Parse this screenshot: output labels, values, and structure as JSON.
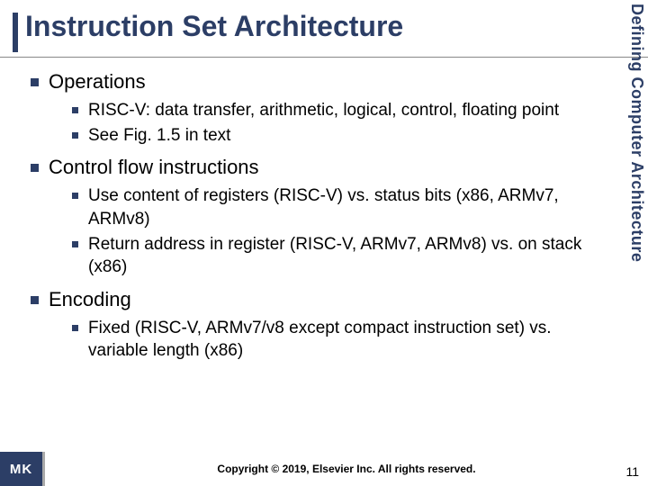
{
  "title": "Instruction Set Architecture",
  "sideLabel": "Defining Computer Architecture",
  "sections": [
    {
      "heading": "Operations",
      "items": [
        "RISC-V:  data transfer, arithmetic, logical, control, floating point",
        "See Fig. 1.5 in text"
      ]
    },
    {
      "heading": "Control flow instructions",
      "items": [
        "Use content of registers (RISC-V) vs. status bits (x86, ARMv7, ARMv8)",
        "Return address in register (RISC-V, ARMv7, ARMv8) vs. on stack (x86)"
      ]
    },
    {
      "heading": "Encoding",
      "items": [
        "Fixed (RISC-V, ARMv7/v8 except compact instruction set) vs. variable length (x86)"
      ]
    }
  ],
  "logo": "MK",
  "copyright": "Copyright © 2019, Elsevier Inc. All rights reserved.",
  "pageNumber": "11"
}
